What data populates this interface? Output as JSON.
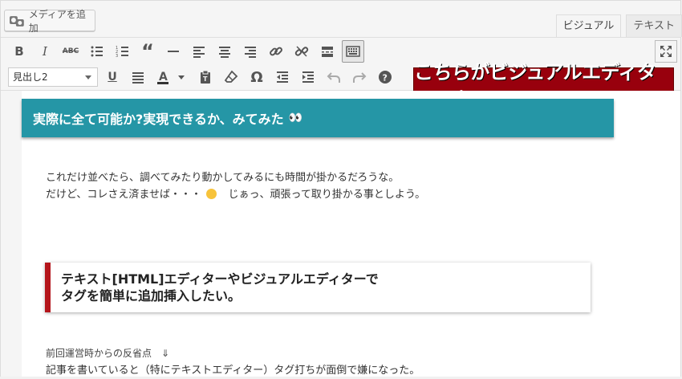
{
  "media_button": {
    "label": "メディアを追加",
    "icon": "media-camera-icon"
  },
  "tabs": [
    {
      "label": "ビジュアル",
      "active": true
    },
    {
      "label": "テキスト",
      "active": false
    }
  ],
  "toolbar": {
    "row1": [
      "bold-icon",
      "italic-icon",
      "strikethrough-icon",
      "bullet-list-icon",
      "numbered-list-icon",
      "blockquote-icon",
      "horizontal-rule-icon",
      "align-left-icon",
      "align-center-icon",
      "align-right-icon",
      "link-icon",
      "unlink-icon",
      "read-more-icon",
      "toolbar-toggle-icon"
    ],
    "row2": [
      "underline-icon",
      "justify-icon",
      "text-color-icon",
      "paste-as-text-icon",
      "clear-formatting-icon",
      "special-character-icon",
      "outdent-icon",
      "indent-icon",
      "undo-icon",
      "redo-icon",
      "help-icon"
    ],
    "fullscreen_icon": "distraction-free-icon",
    "format_select": "見出し2"
  },
  "banner": {
    "text": "こちらがビジュアルエディタでの表示",
    "color": "#98000d"
  },
  "editor": {
    "heading1": "実際に全て可能か?実現できるか、みてみた",
    "heading1_emoji": "👀",
    "para1_line1": "これだけ並べたら、調べてみたり動かしてみるにも時間が掛かるだろうな。",
    "para1_line2a": "だけど、コレさえ済ませば・・・",
    "para1_line2b": "じぁっ、頑張って取り掛かる事としよう。",
    "heading2_line1": "テキスト[HTML]エディターやビジュアルエディターで",
    "heading2_line2": "タグを簡単に追加挿入したい。",
    "line3": "前回運営時からの反省点　⇓",
    "line4": "記事を書いていると（特にテキストエディター）タグ打ちが面倒で嫌になった。",
    "heading1_color": "#2596a6",
    "heading2_accent": "#b4151b"
  }
}
